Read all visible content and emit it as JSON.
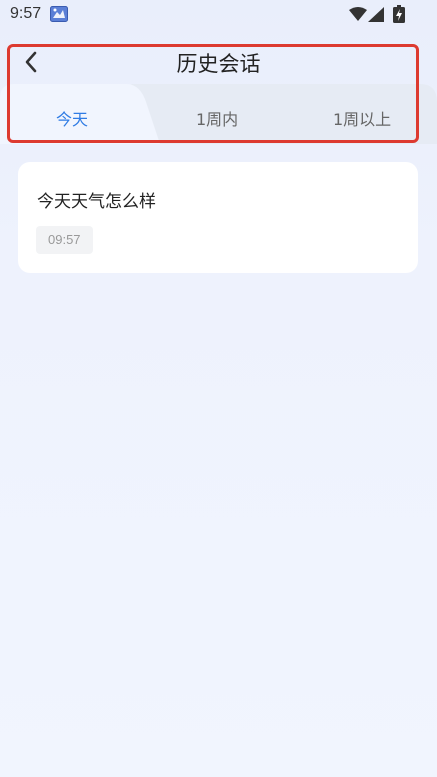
{
  "status_bar": {
    "time": "9:57"
  },
  "header": {
    "title": "历史会话"
  },
  "tabs": [
    {
      "label": "今天",
      "active": true
    },
    {
      "label": "1周内",
      "active": false
    },
    {
      "label": "1周以上",
      "active": false
    }
  ],
  "conversations": [
    {
      "title": "今天天气怎么样",
      "time": "09:57"
    }
  ],
  "colors": {
    "accent": "#2f7be4",
    "highlight": "#dd3a30",
    "background": "#eef2fd"
  },
  "icons": {
    "back": "chevron-left-icon",
    "wifi": "wifi-icon",
    "signal": "signal-icon",
    "battery": "battery-icon"
  }
}
